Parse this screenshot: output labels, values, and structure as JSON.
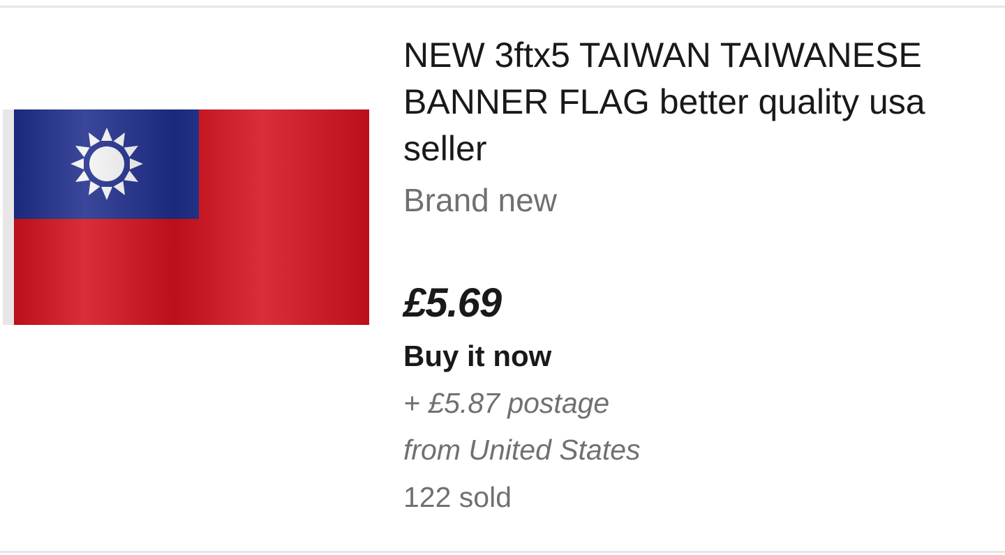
{
  "listing": {
    "title": "NEW 3ftx5 TAIWAN TAIWANESE BANNER FLAG better quality usa seller",
    "condition": "Brand new",
    "price": "£5.69",
    "format": "Buy it now",
    "postage": "+ £5.87 postage",
    "location": "from United States",
    "sold": "122 sold",
    "image": {
      "icon": "taiwan-flag-image",
      "colors": {
        "red": "#d5111e",
        "blue": "#1f2e8c",
        "white": "#f4f4f4"
      }
    }
  }
}
